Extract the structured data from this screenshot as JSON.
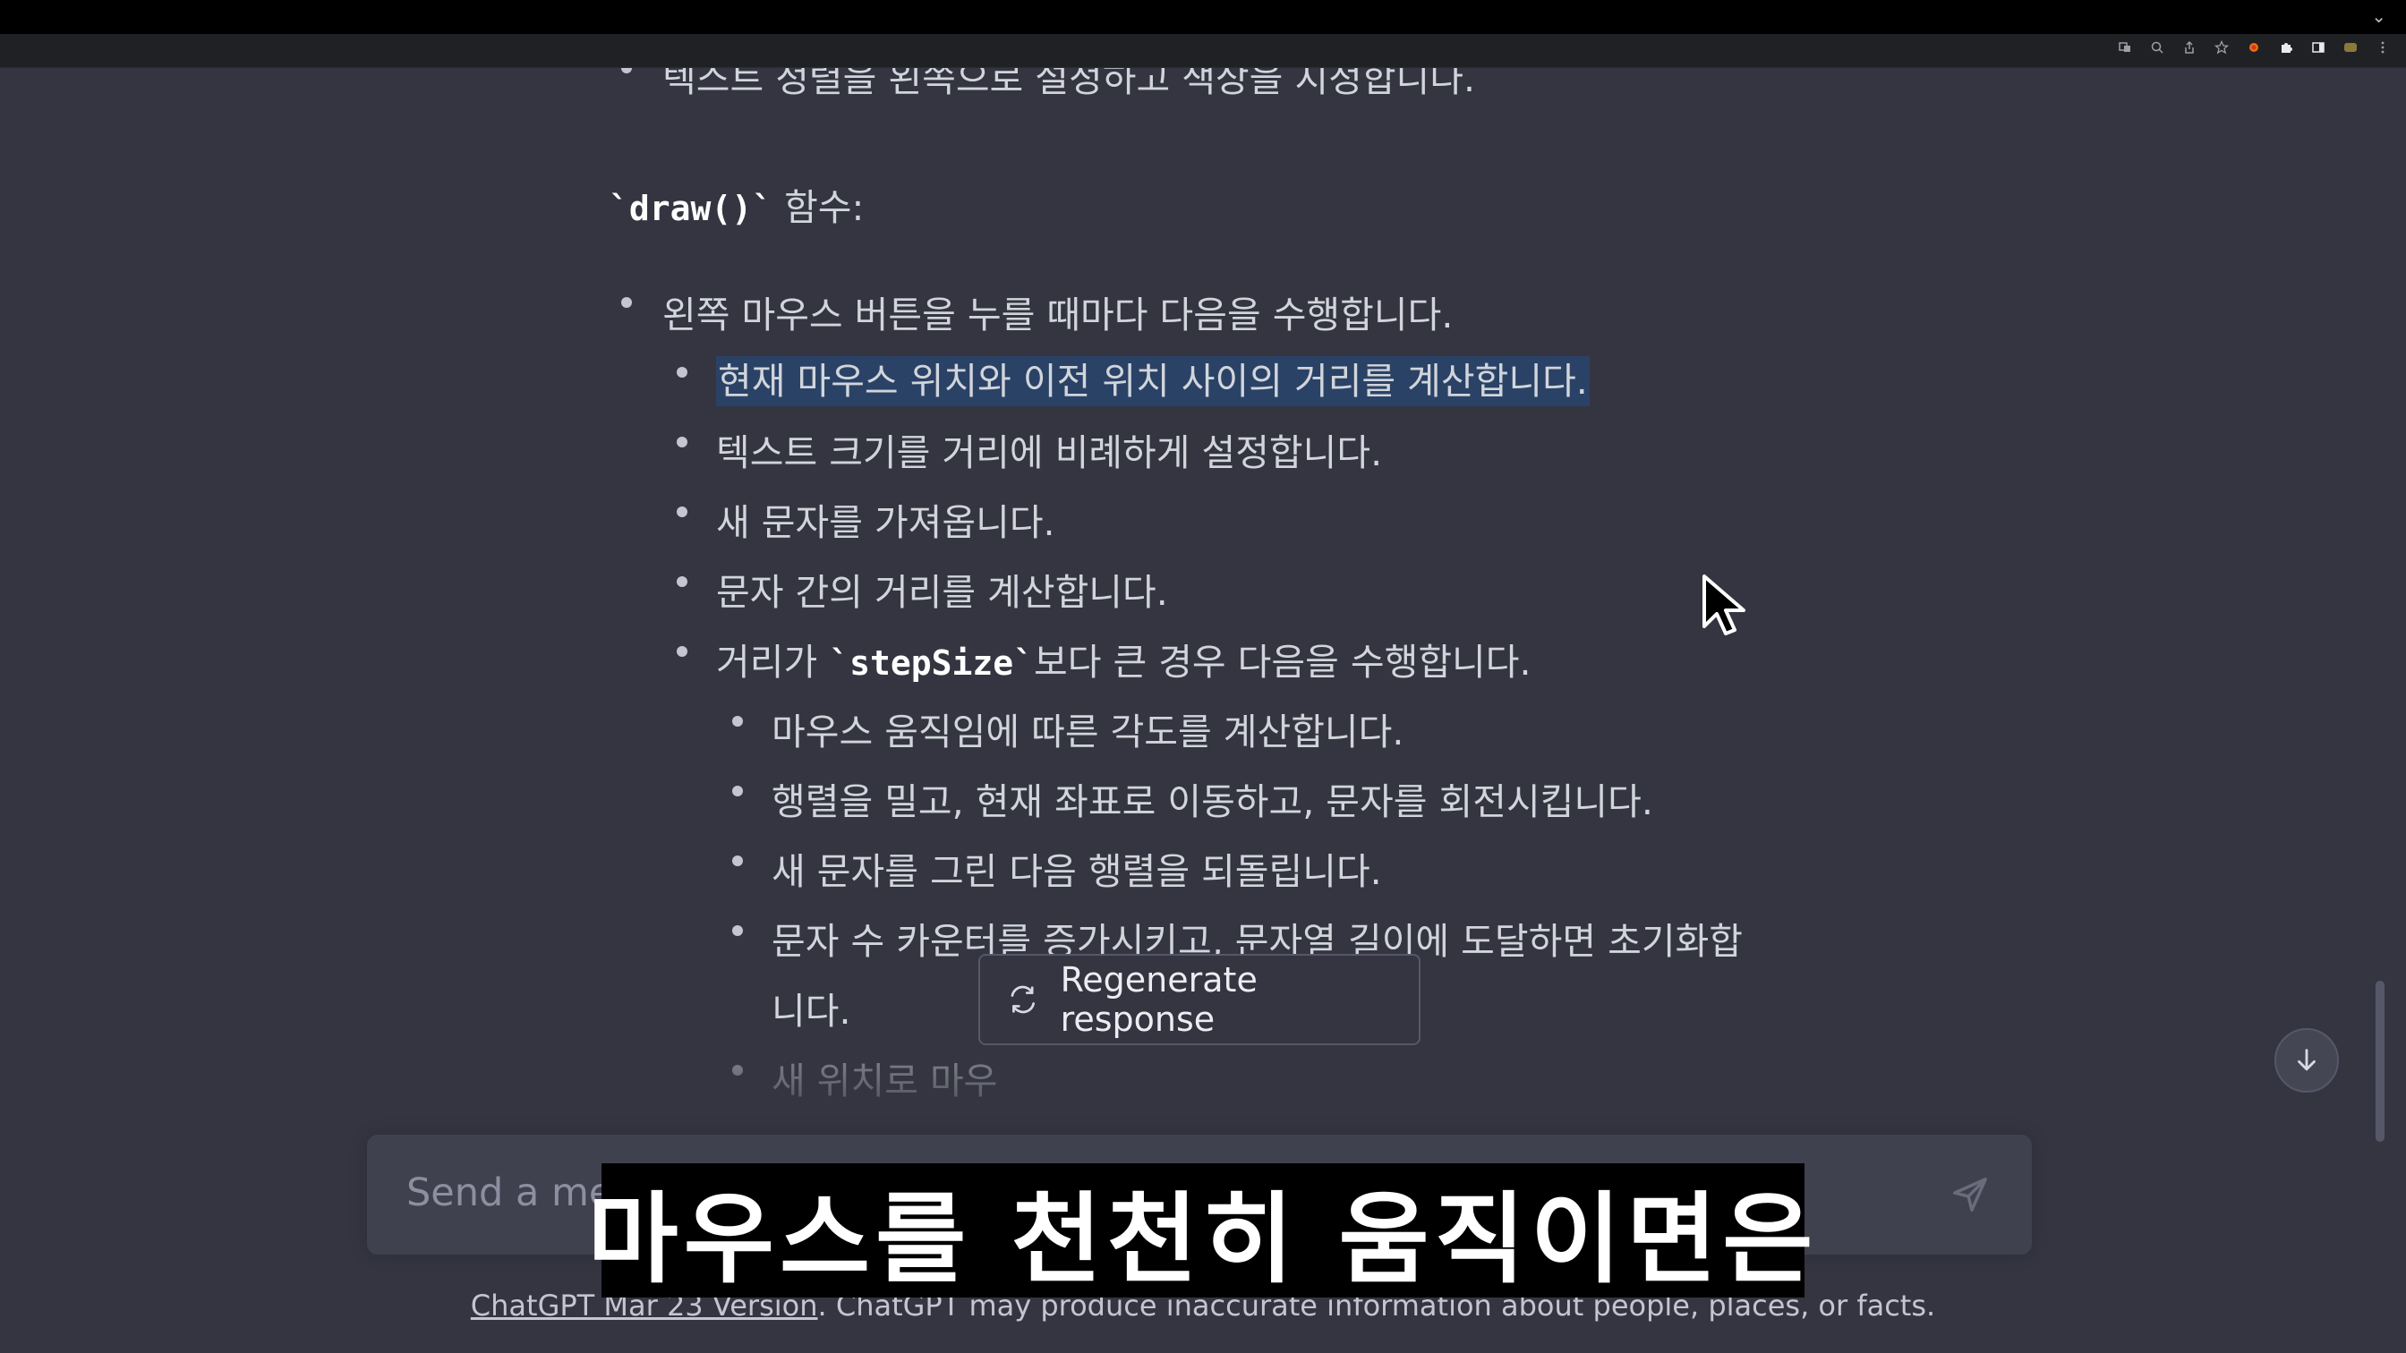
{
  "content": {
    "cut_line": "텍스트 정렬을 왼쪽으로 설정하고 색상을 지정합니다.",
    "draw_heading_code": "`draw()`",
    "draw_heading_suffix": " 함수:",
    "items": [
      "왼쪽 마우스 버튼을 누를 때마다 다음을 수행합니다.",
      "현재 마우스 위치와 이전 위치 사이의 거리를 계산합니다.",
      "텍스트 크기를 거리에 비례하게 설정합니다.",
      "새 문자를 가져옵니다.",
      "문자 간의 거리를 계산합니다.",
      "마우스 움직임에 따른 각도를 계산합니다.",
      "행렬을 밀고, 현재 좌표로 이동하고, 문자를 회전시킵니다.",
      "새 문자를 그린 다음 행렬을 되돌립니다.",
      "문자 수 카운터를 증가시키고, 문자열 길이에 도달하면 초기화합",
      "니다.",
      "새 위치로 마우"
    ],
    "step_prefix": "거리가 ",
    "step_code": "`stepSize`",
    "step_suffix": "보다 큰 경우 다음을 수행합니다."
  },
  "regenerate_label": "Regenerate response",
  "input": {
    "placeholder": "Send a mes"
  },
  "footer": {
    "link": "ChatGPT Mar 23 Version",
    "text": ". ChatGPT may produce inaccurate information about people, places, or facts."
  },
  "subtitle": "마우스를 천천히 움직이면은",
  "icons": {
    "regenerate": "refresh-icon",
    "scroll": "arrow-down-icon",
    "send": "send-icon"
  }
}
